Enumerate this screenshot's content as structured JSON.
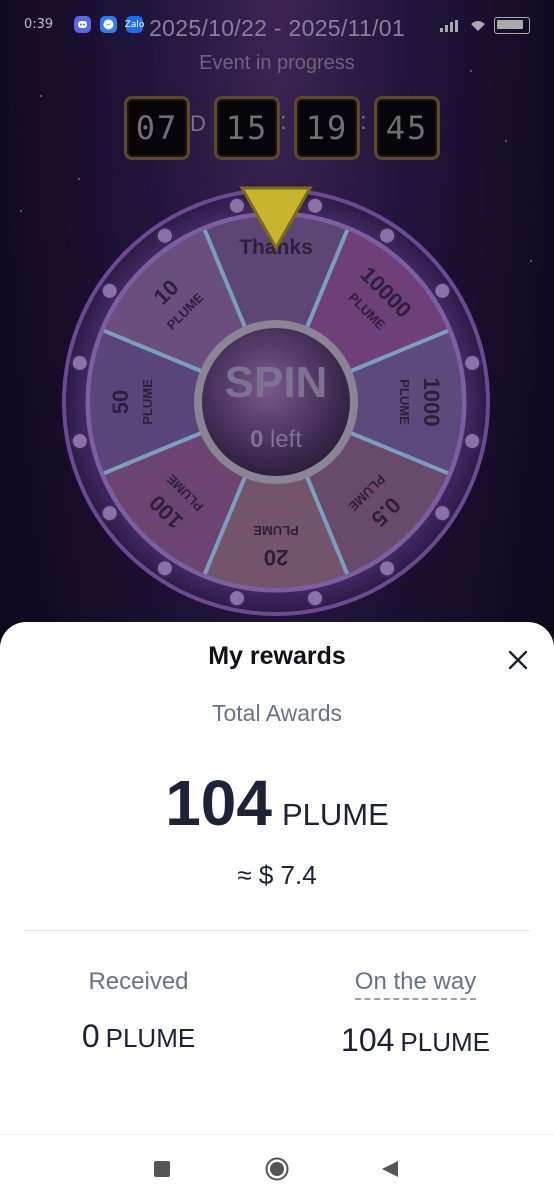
{
  "status_bar": {
    "time": "0:39",
    "apps": [
      {
        "icon": "discord-icon",
        "color": "#5865f2"
      },
      {
        "icon": "messenger-icon",
        "color": "#2b7ff5"
      },
      {
        "icon": "zalo-icon",
        "color": "#1b6ef0",
        "text": "Zalo"
      }
    ]
  },
  "event": {
    "date_range": "2025/10/22 - 2025/11/01",
    "status": "Event in progress",
    "countdown": {
      "days": "07",
      "day_unit": "D",
      "hours": "15",
      "minutes": "19",
      "seconds": "45",
      "separator": ":"
    }
  },
  "wheel": {
    "pointer_color": "#d6c23a",
    "segments": [
      {
        "amount": "Thanks",
        "unit": ""
      },
      {
        "amount": "10000",
        "unit": "PLUME"
      },
      {
        "amount": "1000",
        "unit": "PLUME"
      },
      {
        "amount": "0.5",
        "unit": "PLUME"
      },
      {
        "amount": "20",
        "unit": "PLUME"
      },
      {
        "amount": "100",
        "unit": "PLUME"
      },
      {
        "amount": "50",
        "unit": "PLUME"
      },
      {
        "amount": "10",
        "unit": "PLUME"
      }
    ],
    "spin_label": "SPIN",
    "spins_left": "0",
    "spins_left_suffix": "left"
  },
  "rewards": {
    "title": "My rewards",
    "total_label": "Total Awards",
    "total_amount": "104",
    "total_unit": "PLUME",
    "approx_value": "≈ $ 7.4",
    "received_label": "Received",
    "received_amount": "0",
    "received_unit": "PLUME",
    "on_the_way_label": "On the way",
    "on_the_way_amount": "104",
    "on_the_way_unit": "PLUME"
  },
  "nav": {
    "buttons": [
      "recents-square-icon",
      "home-circle-icon",
      "back-triangle-icon"
    ]
  }
}
